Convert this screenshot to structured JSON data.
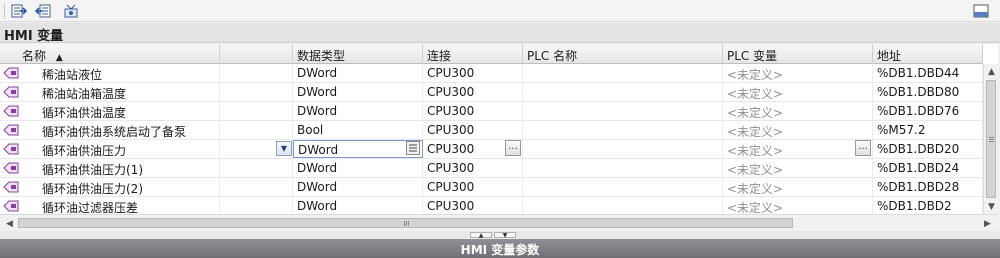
{
  "section_title": "HMI 变量",
  "columns": [
    {
      "label": "名称",
      "sort": "ascending"
    },
    {
      "label": "数据类型"
    },
    {
      "label": "连接"
    },
    {
      "label": "PLC 名称"
    },
    {
      "label": "PLC 变量"
    },
    {
      "label": "地址"
    }
  ],
  "rows": [
    {
      "name": "稀油站液位",
      "datatype": "DWord",
      "connection": "CPU300",
      "plc_name": "",
      "plc_var": "<未定义>",
      "address": "%DB1.DBD44"
    },
    {
      "name": "稀油站油箱温度",
      "datatype": "DWord",
      "connection": "CPU300",
      "plc_name": "",
      "plc_var": "<未定义>",
      "address": "%DB1.DBD80"
    },
    {
      "name": "循环油供油温度",
      "datatype": "DWord",
      "connection": "CPU300",
      "plc_name": "",
      "plc_var": "<未定义>",
      "address": "%DB1.DBD76"
    },
    {
      "name": "循环油供油系统启动了备泵",
      "datatype": "Bool",
      "connection": "CPU300",
      "plc_name": "",
      "plc_var": "<未定义>",
      "address": "%M57.2"
    },
    {
      "name": "循环油供油压力",
      "datatype": "DWord",
      "connection": "CPU300",
      "plc_name": "",
      "plc_var": "<未定义>",
      "address": "%DB1.DBD20",
      "selected": true
    },
    {
      "name": "循环油供油压力(1)",
      "datatype": "DWord",
      "connection": "CPU300",
      "plc_name": "",
      "plc_var": "<未定义>",
      "address": "%DB1.DBD24"
    },
    {
      "name": "循环油供油压力(2)",
      "datatype": "DWord",
      "connection": "CPU300",
      "plc_name": "",
      "plc_var": "<未定义>",
      "address": "%DB1.DBD28"
    },
    {
      "name": "循环油过滤器压差",
      "datatype": "DWord",
      "connection": "CPU300",
      "plc_name": "",
      "plc_var": "<未定义>",
      "address": "%DB1.DBD2"
    }
  ],
  "ellipsis_label": "...",
  "properties_bar": "HMI 变量参数",
  "icons": {
    "toolbar": [
      "insert-row-icon",
      "export-icon",
      "tag-settings-icon"
    ],
    "top_right": "window-layout-icon",
    "row": "hmi-tag-icon"
  },
  "colors": {
    "selection_border": "#7a9cc8",
    "undefined_text": "#909090",
    "properties_bar": "#7f8186",
    "tag_icon": "#8a3fa0"
  }
}
